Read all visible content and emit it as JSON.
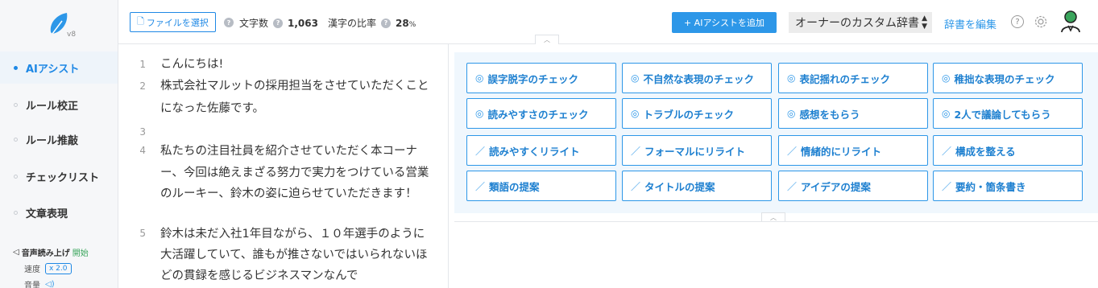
{
  "app": {
    "version": "v8"
  },
  "sidebar": {
    "items": [
      {
        "label": "AIアシスト",
        "active": true
      },
      {
        "label": "ルール校正",
        "active": false
      },
      {
        "label": "ルール推敲",
        "active": false
      },
      {
        "label": "チェックリスト",
        "active": false
      },
      {
        "label": "文章表現",
        "active": false
      }
    ],
    "tts": {
      "label": "音声読み上げ",
      "start": "開始",
      "speed_label": "速度",
      "speed_value": "x 2.0",
      "volume_label": "音量"
    }
  },
  "topbar": {
    "file_button": "ファイルを選択",
    "char_count_label": "文字数",
    "char_count": "1,063",
    "kanji_ratio_label": "漢字の比率",
    "kanji_ratio": "28",
    "kanji_ratio_unit": "%",
    "ai_add_button": "+ AIアシストを追加",
    "dictionary_select": "オーナーのカスタム辞書",
    "dictionary_edit": "辞書を編集"
  },
  "editor": {
    "lines": [
      {
        "num": "1",
        "text": "こんにちは!"
      },
      {
        "num": "2",
        "text": "株式会社マルットの採用担当をさせていただくことになった佐藤です。"
      },
      {
        "num": "3",
        "text": ""
      },
      {
        "num": "4",
        "text": "私たちの注目社員を紹介させていただく本コーナー、今回は絶えまざる努力で実力をつけている営業のルーキー、鈴木の姿に迫らせていただきます！"
      },
      {
        "num": "5",
        "text": "鈴木は未だ入社1年目ながら、１０年選手のように大活躍していて、誰もが推さないではいられないほどの貫録を感じるビジネスマンなんで"
      }
    ]
  },
  "ai_actions": [
    {
      "label": "誤字脱字のチェック",
      "icon": "check-circle-icon"
    },
    {
      "label": "不自然な表現のチェック",
      "icon": "check-circle-icon"
    },
    {
      "label": "表記揺れのチェック",
      "icon": "check-circle-icon"
    },
    {
      "label": "稚拙な表現のチェック",
      "icon": "check-circle-icon"
    },
    {
      "label": "読みやすさのチェック",
      "icon": "check-circle-icon"
    },
    {
      "label": "トラブルのチェック",
      "icon": "check-circle-icon"
    },
    {
      "label": "感想をもらう",
      "icon": "check-circle-icon"
    },
    {
      "label": "2人で議論してもらう",
      "icon": "check-circle-icon"
    },
    {
      "label": "読みやすくリライト",
      "icon": "pencil-icon"
    },
    {
      "label": "フォーマルにリライト",
      "icon": "pencil-icon"
    },
    {
      "label": "情緒的にリライト",
      "icon": "pencil-icon"
    },
    {
      "label": "構成を整える",
      "icon": "pencil-icon"
    },
    {
      "label": "類語の提案",
      "icon": "pencil-icon"
    },
    {
      "label": "タイトルの提案",
      "icon": "pencil-icon"
    },
    {
      "label": "アイデアの提案",
      "icon": "pencil-icon"
    },
    {
      "label": "要約・箇条書き",
      "icon": "pencil-icon"
    }
  ],
  "colors": {
    "accent": "#2d97e8",
    "active_nav": "#1e88e5",
    "panel_bg": "#f0f7fd"
  }
}
